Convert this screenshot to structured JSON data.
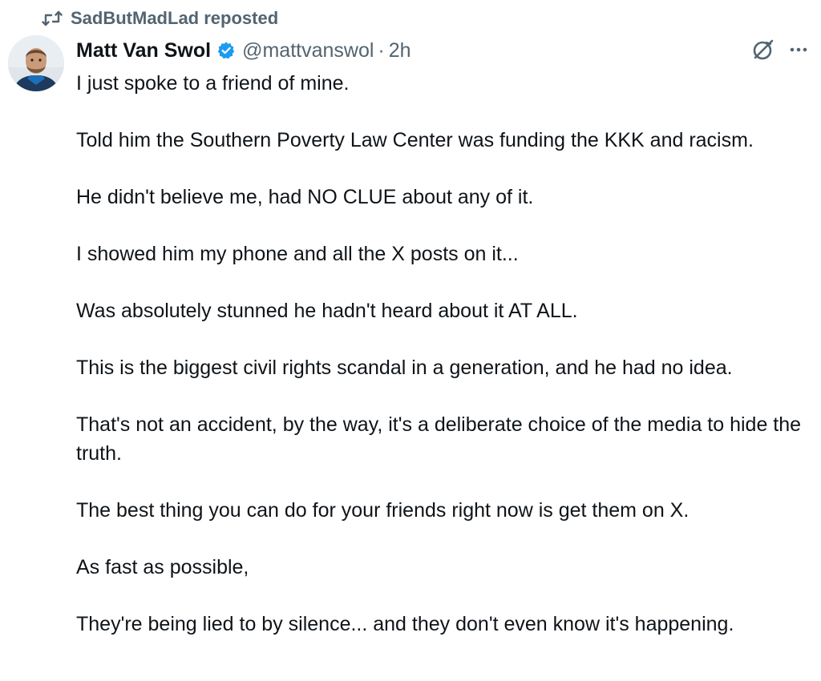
{
  "repost": {
    "icon": "repost-icon",
    "label": "SadButMadLad reposted"
  },
  "author": {
    "avatar": "avatar",
    "name": "Matt Van Swol",
    "verified_icon": "verified-badge-icon",
    "handle": "@mattvanswol",
    "separator": "·",
    "time": "2h"
  },
  "actions": {
    "grok_icon": "grok-icon",
    "more_icon": "more-icon"
  },
  "post": {
    "paragraphs": [
      "I just spoke to a friend of mine.",
      "Told him the Southern Poverty Law Center was funding the KKK and racism.",
      "He didn't believe me, had NO CLUE about any of it.",
      "I showed him my phone and all the X posts on it...",
      "Was absolutely stunned he hadn't heard about it AT ALL.",
      "This is the biggest civil rights scandal in a generation, and he had no idea.",
      "That's not an accident, by the way, it's a deliberate choice of the media to hide the truth.",
      "The best thing you can do for your friends right now is get them on X.",
      "As fast as possible,",
      "They're being lied to by silence... and they don't even know it's happening."
    ]
  },
  "colors": {
    "text": "#0f1419",
    "secondary": "#536471",
    "verified": "#1d9bf0"
  }
}
